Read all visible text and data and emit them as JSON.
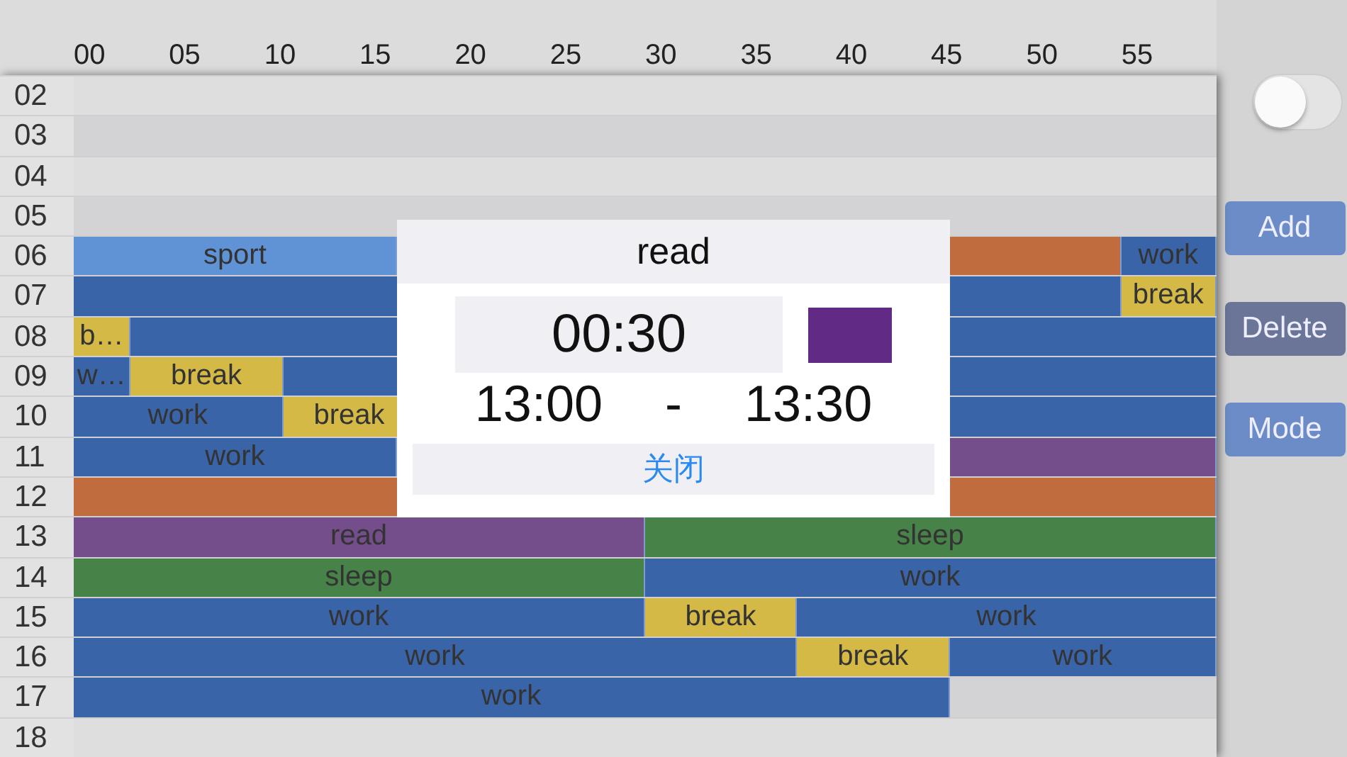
{
  "minute_ticks": [
    "00",
    "05",
    "10",
    "15",
    "20",
    "25",
    "30",
    "35",
    "40",
    "45",
    "50",
    "55"
  ],
  "rows": [
    {
      "hour": "02",
      "blocks": []
    },
    {
      "hour": "03",
      "blocks": []
    },
    {
      "hour": "04",
      "blocks": []
    },
    {
      "hour": "05",
      "blocks": []
    },
    {
      "hour": "06",
      "blocks": [
        {
          "label": "sport",
          "color": "#5f93d6"
        },
        {
          "color": "#c16c3e"
        },
        {
          "label": "work",
          "color": "#3a64a8"
        }
      ]
    },
    {
      "hour": "07",
      "blocks": [
        {
          "color": "#3a64a8"
        },
        {
          "label": "break",
          "color": "#d4b946"
        }
      ]
    },
    {
      "hour": "08",
      "blocks": [
        {
          "label": "b…",
          "color": "#d4b946"
        },
        {
          "color": "#3a64a8"
        }
      ]
    },
    {
      "hour": "09",
      "blocks": [
        {
          "label": "w…",
          "color": "#3a64a8"
        },
        {
          "label": "break",
          "color": "#d4b946"
        },
        {
          "color": "#3a64a8"
        }
      ]
    },
    {
      "hour": "10",
      "blocks": [
        {
          "label": "work",
          "color": "#3a64a8"
        },
        {
          "label": "break",
          "color": "#d4b946"
        },
        {
          "color": "#3a64a8"
        }
      ]
    },
    {
      "hour": "11",
      "blocks": [
        {
          "label": "work",
          "color": "#3a64a8"
        },
        {
          "color": "#744d8b"
        }
      ]
    },
    {
      "hour": "12",
      "blocks": [
        {
          "color": "#c16c3e"
        }
      ]
    },
    {
      "hour": "13",
      "blocks": [
        {
          "label": "read",
          "color": "#744d8b"
        },
        {
          "label": "sleep",
          "color": "#478248"
        }
      ]
    },
    {
      "hour": "14",
      "blocks": [
        {
          "label": "sleep",
          "color": "#478248"
        },
        {
          "label": "work",
          "color": "#3a64a8"
        }
      ]
    },
    {
      "hour": "15",
      "blocks": [
        {
          "label": "work",
          "color": "#3a64a8"
        },
        {
          "label": "break",
          "color": "#d4b946"
        },
        {
          "label": "work",
          "color": "#3a64a8"
        }
      ]
    },
    {
      "hour": "16",
      "blocks": [
        {
          "label": "work",
          "color": "#3a64a8"
        },
        {
          "label": "break",
          "color": "#d4b946"
        },
        {
          "label": "work",
          "color": "#3a64a8"
        }
      ]
    },
    {
      "hour": "17",
      "blocks": [
        {
          "label": "work",
          "color": "#3a64a8"
        }
      ]
    },
    {
      "hour": "18",
      "blocks": []
    }
  ],
  "side_panel": {
    "toggle": {
      "on": false
    },
    "buttons": [
      {
        "label": "Add",
        "selected": false
      },
      {
        "label": "Delete",
        "selected": true
      },
      {
        "label": "Mode",
        "selected": false
      }
    ]
  },
  "popup": {
    "title": "read",
    "duration": "00:30",
    "color": "#612a85",
    "start_time": "13:00",
    "separator": "-",
    "end_time": "13:30",
    "close_button": "关闭"
  }
}
